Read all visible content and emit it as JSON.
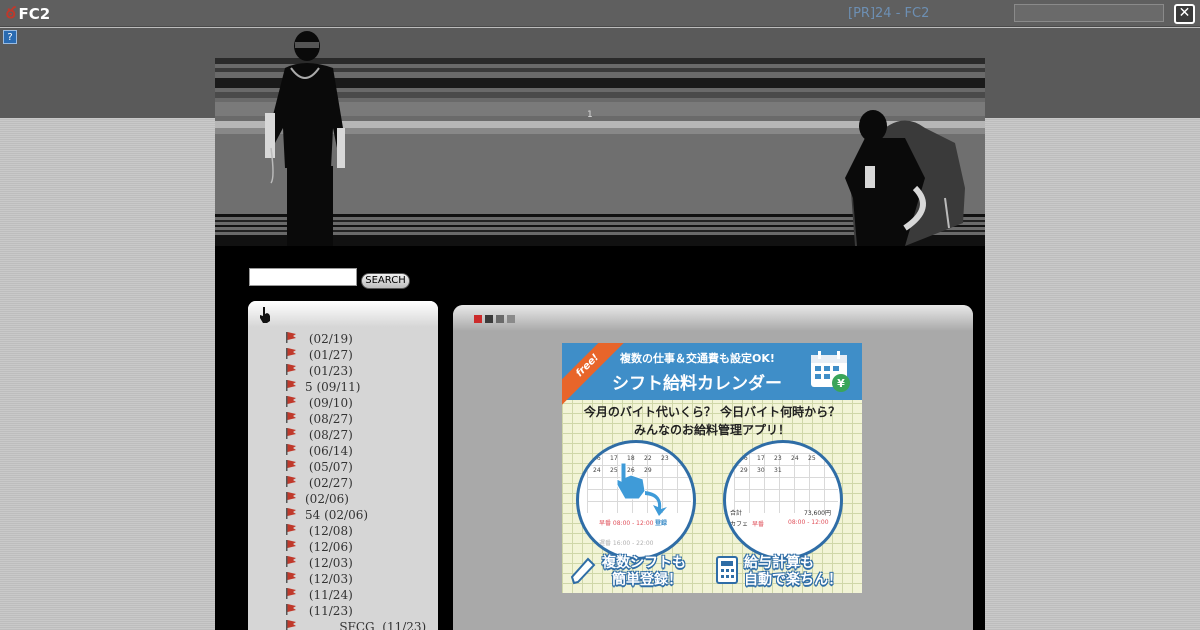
{
  "fc2_bar": {
    "logo_text": "FC2",
    "site_title": "[PR]24 - FC2",
    "search_placeholder": "",
    "close_symbol": "✕",
    "help_symbol": "?"
  },
  "header": {
    "counter_text": "1"
  },
  "blog_search": {
    "value": "",
    "button_label": "SEARCH"
  },
  "sidebar": {
    "icon": "hand-pointer-icon",
    "entries": [
      {
        "label": " (02/19)"
      },
      {
        "label": " (01/27)"
      },
      {
        "label": " (01/23)"
      },
      {
        "label": "5 (09/11)"
      },
      {
        "label": " (09/10)"
      },
      {
        "label": " (08/27)"
      },
      {
        "label": " (08/27)"
      },
      {
        "label": " (06/14)"
      },
      {
        "label": " (05/07)"
      },
      {
        "label": " (02/27)"
      },
      {
        "label": "(02/06)"
      },
      {
        "label": "54 (02/06)"
      },
      {
        "label": " (12/08)"
      },
      {
        "label": " (12/06)"
      },
      {
        "label": " (12/03)"
      },
      {
        "label": " (12/03)"
      },
      {
        "label": " (11/24)"
      },
      {
        "label": " (11/23)"
      },
      {
        "label": "         SFCG  (11/23)"
      }
    ]
  },
  "content": {
    "tab_colors": [
      "#cc2b2b",
      "#3a3a3a",
      "#6a6a6a",
      "#8a8a8a"
    ]
  },
  "ad": {
    "badge": "free!",
    "line1": "複数の仕事＆交通費も設定OK!",
    "line2": "シフト給料カレンダー",
    "question1": "今月のバイト代いくら？ 今日バイト何時から？",
    "question2": "みんなのお給料管理アプリ！",
    "caption_left_1": "複数シフトも",
    "caption_left_2": "簡単登録！",
    "caption_right_1": "給与計算も",
    "caption_right_2": "自動で楽ちん！",
    "left_circle": {
      "dates": [
        "16",
        "17",
        "18",
        "22",
        "23",
        "24",
        "25",
        "26",
        "29"
      ],
      "shift1": "早番 08:00 - 12:00",
      "register": "登録",
      "shift2": "遅番 16:00 - 22:00"
    },
    "right_circle": {
      "dates": [
        "16",
        "17",
        "23",
        "24",
        "25",
        "29",
        "30",
        "31"
      ],
      "total_label": "合計",
      "total_value": "73,600円",
      "row_label": "カフェ",
      "row_shift": "早番",
      "row_time": "08:00 - 12:00"
    },
    "colors": {
      "blue": "#3f8ec8",
      "orange": "#e8652a",
      "dark_blue": "#2f6da6"
    }
  }
}
